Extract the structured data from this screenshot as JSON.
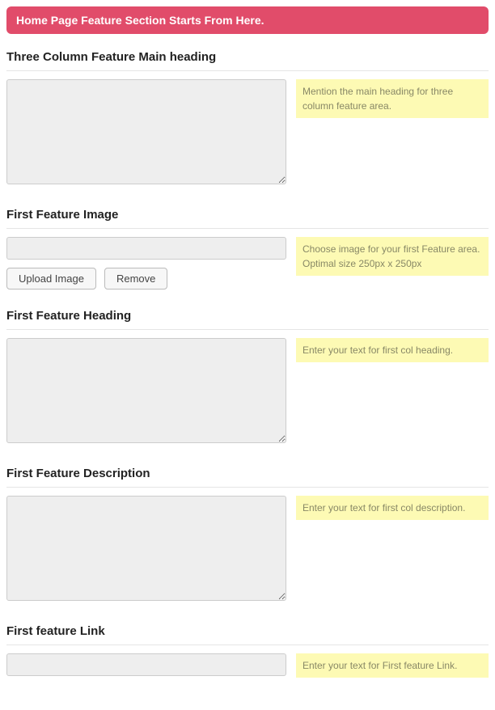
{
  "section_banner": "Home Page Feature Section Starts From Here.",
  "fields": {
    "main_heading": {
      "label": "Three Column Feature Main heading",
      "value": "",
      "hint": "Mention the main heading for three column feature area."
    },
    "first_image": {
      "label": "First Feature Image",
      "value": "",
      "hint": "Choose image for your first Feature area. Optimal size 250px x 250px",
      "upload_label": "Upload Image",
      "remove_label": "Remove"
    },
    "first_heading": {
      "label": "First Feature Heading",
      "value": "",
      "hint": "Enter your text for first col heading."
    },
    "first_description": {
      "label": "First Feature Description",
      "value": "",
      "hint": "Enter your text for first col description."
    },
    "first_link": {
      "label": "First feature Link",
      "value": "",
      "hint": "Enter your text for First feature Link."
    }
  }
}
